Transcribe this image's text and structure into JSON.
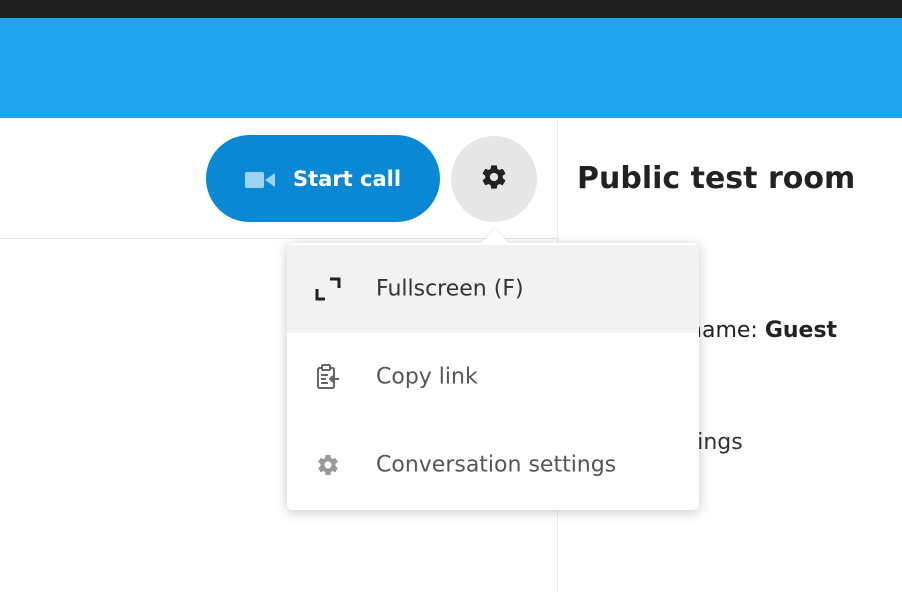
{
  "header": {
    "accent_color": "#1da6ef"
  },
  "toolbar": {
    "start_call_label": "Start call",
    "start_call_icon": "video-camera-icon",
    "start_call_color": "#0a88d3",
    "settings_icon": "gear-icon"
  },
  "menu": {
    "items": [
      {
        "label": "Fullscreen (F)",
        "icon": "fullscreen-icon",
        "active": true
      },
      {
        "label": "Copy link",
        "icon": "clipboard-icon",
        "active": false
      },
      {
        "label": "Conversation settings",
        "icon": "gear-icon",
        "active": false
      }
    ]
  },
  "sidebar": {
    "title": "Public test room",
    "name_prefix": "y name: ",
    "name_value": "Guest",
    "settings_fragment": "ttings"
  }
}
